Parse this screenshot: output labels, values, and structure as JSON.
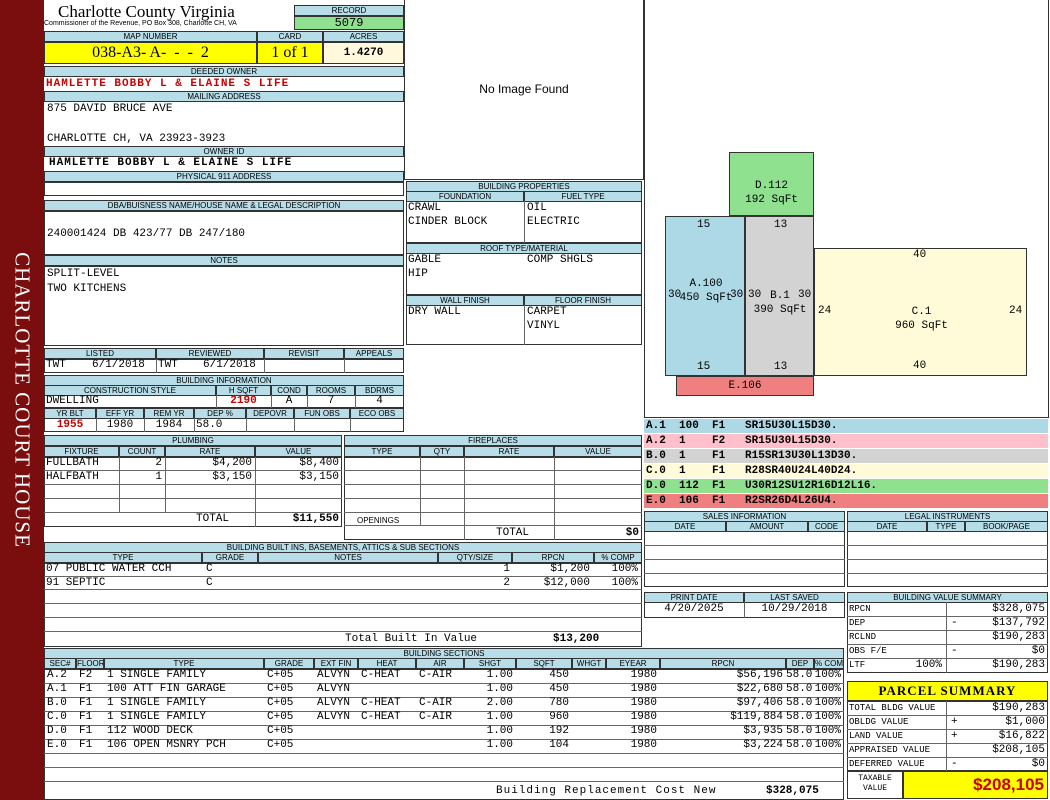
{
  "side_title": "CHARLOTTE COURT HOUSE",
  "header": {
    "county": "Charlotte County Virginia",
    "commissioner": "Commissioner of the Revenue, PO Box 308, Charlotte CH, VA",
    "record_label": "RECORD",
    "record": "5079",
    "map_number_label": "MAP NUMBER",
    "map_number": "038-A3- A-  -  -  2",
    "card_label": "CARD",
    "card": "1 of 1",
    "acres_label": "ACRES",
    "acres": "1.4270"
  },
  "owner": {
    "deeded_label": "DEEDED OWNER",
    "deeded_owner": "HAMLETTE BOBBY L & ELAINE S LIFE",
    "mailing_label": "MAILING ADDRESS",
    "mailing_line1": "875 DAVID BRUCE AVE",
    "mailing_line2": "",
    "mailing_line3": "CHARLOTTE CH, VA 23923-3923",
    "owner_id_label": "OWNER ID",
    "owner_id": "HAMLETTE BOBBY L & ELAINE S LIFE",
    "physical_label": "PHYSICAL 911 ADDRESS",
    "physical": ""
  },
  "dba": {
    "label": "DBA/BUISNESS NAME/HOUSE NAME & LEGAL DESCRIPTION",
    "text": "240001424 DB 423/77 DB 247/180"
  },
  "notes": {
    "label": "NOTES",
    "line1": "SPLIT-LEVEL",
    "line2": "TWO KITCHENS"
  },
  "image_placeholder": "No Image Found",
  "review": {
    "listed_label": "LISTED",
    "reviewed_label": "REVIEWED",
    "revisit_label": "REVISIT",
    "appeals_label": "APPEALS",
    "listed_by": "TWT",
    "listed_date": "6/1/2018",
    "reviewed_by": "TWT",
    "reviewed_date": "6/1/2018"
  },
  "building_info": {
    "label": "BUILDING INFORMATION",
    "style_label": "CONSTRUCTION STYLE",
    "hsqft_label": "H SQFT",
    "cond_label": "COND",
    "rooms_label": "ROOMS",
    "bdrms_label": "BDRMS",
    "style": "DWELLING",
    "hsqft": "2190",
    "cond": "A",
    "rooms": "7",
    "bdrms": "4",
    "yrblt_label": "YR BLT",
    "effyr_label": "EFF YR",
    "remyr_label": "REM YR",
    "dep_label": "DEP %",
    "depovr_label": "DEPOVR",
    "funobs_label": "FUN OBS",
    "ecoobs_label": "ECO OBS",
    "yrblt": "1955",
    "effyr": "1980",
    "remyr": "1984",
    "dep": "58.0"
  },
  "building_properties": {
    "label": "BUILDING PROPERTIES",
    "foundation_label": "FOUNDATION",
    "fuel_label": "FUEL TYPE",
    "foundation1": "CRAWL",
    "foundation2": "CINDER BLOCK",
    "fuel1": "OIL",
    "fuel2": "ELECTRIC",
    "roof_label": "ROOF TYPE/MATERIAL",
    "roof1": "GABLE",
    "roof2": "HIP",
    "roof_material": "COMP SHGLS",
    "wall_label": "WALL FINISH",
    "floor_label": "FLOOR FINISH",
    "wall": "DRY WALL",
    "floor1": "CARPET",
    "floor2": "VINYL"
  },
  "plumbing": {
    "label": "PLUMBING",
    "headers": [
      "FIXTURE",
      "COUNT",
      "RATE",
      "VALUE"
    ],
    "rows": [
      {
        "fixture": "FULLBATH",
        "count": "2",
        "rate": "$4,200",
        "value": "$8,400"
      },
      {
        "fixture": "HALFBATH",
        "count": "1",
        "rate": "$3,150",
        "value": "$3,150"
      }
    ],
    "total_label": "TOTAL",
    "total": "$11,550"
  },
  "fireplaces": {
    "label": "FIREPLACES",
    "headers": [
      "TYPE",
      "QTY",
      "RATE",
      "VALUE"
    ],
    "openings_label": "OPENINGS",
    "total_label": "TOTAL",
    "total": "$0"
  },
  "built_ins": {
    "label": "BUILDING BUILT INS, BASEMENTS, ATTICS & SUB SECTIONS",
    "headers": [
      "TYPE",
      "GRADE",
      "NOTES",
      "QTY/SIZE",
      "RPCN",
      "% COMP"
    ],
    "rows": [
      {
        "type": "07 PUBLIC WATER CCH",
        "grade": "C",
        "qty": "1",
        "rpcn": "$1,200",
        "comp": "100%"
      },
      {
        "type": "91 SEPTIC",
        "grade": "C",
        "qty": "2",
        "rpcn": "$12,000",
        "comp": "100%"
      }
    ],
    "total_label": "Total Built In Value",
    "total": "$13,200"
  },
  "sketch": {
    "areas": [
      {
        "code": "D.112",
        "sqft": "192 SqFt",
        "color": "#8fe08f"
      },
      {
        "code": "A.100",
        "sqft": "450 SqFt",
        "color": "#add8e6"
      },
      {
        "code": "B.1",
        "sqft": "390 SqFt",
        "color": "#d3d3d3"
      },
      {
        "code": "C.1",
        "sqft": "960 SqFt",
        "color": "#fffbd8"
      },
      {
        "code": "E.106",
        "sqft": "",
        "color": "#f08080"
      }
    ],
    "dims": {
      "a_top": "15",
      "a_bottom": "15",
      "a_left": "30",
      "a_right": "30",
      "b_top": "13",
      "b_bottom": "13",
      "b_left": "30",
      "b_right": "30",
      "c_top": "40",
      "c_bottom": "40",
      "c_left": "24",
      "c_right": "24"
    }
  },
  "segments": [
    {
      "text": "A.1  100  F1   SR15U30L15D30.",
      "color": "#add8e6"
    },
    {
      "text": "A.2  1    F2   SR15U30L15D30.",
      "color": "#ffc0cb"
    },
    {
      "text": "B.0  1    F1   R15SR13U30L13D30.",
      "color": "#d3d3d3"
    },
    {
      "text": "C.0  1    F1   R28SR40U24L40D24.",
      "color": "#fffbd8"
    },
    {
      "text": "D.0  112  F1   U30R12SU12R16D12L16.",
      "color": "#8fe08f"
    },
    {
      "text": "E.0  106  F1   R2SR26D4L26U4.",
      "color": "#f08080"
    }
  ],
  "sales": {
    "label": "SALES INFORMATION",
    "headers": [
      "DATE",
      "AMOUNT",
      "CODE"
    ]
  },
  "legal": {
    "label": "LEGAL INSTRUMENTS",
    "headers": [
      "DATE",
      "TYPE",
      "BOOK/PAGE"
    ]
  },
  "dates": {
    "print_label": "PRINT DATE",
    "saved_label": "LAST SAVED",
    "print": "4/20/2025",
    "saved": "10/29/2018"
  },
  "value_summary": {
    "label": "BUILDING VALUE SUMMARY",
    "rows": [
      {
        "label": "RPCN",
        "sign": "",
        "value": "$328,075"
      },
      {
        "label": "DEP",
        "sign": "-",
        "value": "$137,792"
      },
      {
        "label": "RCLND",
        "sign": "",
        "value": "$190,283"
      },
      {
        "label": "OBS F/E",
        "sign": "-",
        "value": "$0"
      },
      {
        "label": "LTF",
        "pct": "100%",
        "sign": "",
        "value": "$190,283"
      }
    ]
  },
  "parcel": {
    "label": "PARCEL SUMMARY",
    "rows": [
      {
        "label": "TOTAL BLDG VALUE",
        "sign": "",
        "value": "$190,283"
      },
      {
        "label": "OBLDG VALUE",
        "sign": "+",
        "value": "$1,000"
      },
      {
        "label": "LAND VALUE",
        "sign": "+",
        "value": "$16,822"
      },
      {
        "label": "APPRAISED VALUE",
        "sign": "",
        "value": "$208,105"
      },
      {
        "label": "DEFERRED VALUE",
        "sign": "-",
        "value": "$0"
      }
    ],
    "taxable_label1": "TAXABLE",
    "taxable_label2": "VALUE",
    "taxable": "$208,105"
  },
  "sections": {
    "label": "BUILDING SECTIONS",
    "headers": [
      "SEC#",
      "FLOOR",
      "TYPE",
      "GRADE",
      "EXT FIN",
      "HEAT",
      "AIR",
      "SHGT",
      "SQFT",
      "WHGT",
      "EYEAR",
      "RPCN",
      "DEP",
      "% COMP"
    ],
    "rows": [
      [
        "A.2",
        "F2",
        "1 SINGLE FAMILY",
        "C+05",
        "ALVYN",
        "C-HEAT",
        "C-AIR",
        "1.00",
        "450",
        "",
        "1980",
        "$56,196",
        "58.0",
        "100%"
      ],
      [
        "A.1",
        "F1",
        "100 ATT FIN GARAGE",
        "C+05",
        "ALVYN",
        "",
        "",
        "1.00",
        "450",
        "",
        "1980",
        "$22,680",
        "58.0",
        "100%"
      ],
      [
        "B.0",
        "F1",
        "1 SINGLE FAMILY",
        "C+05",
        "ALVYN",
        "C-HEAT",
        "C-AIR",
        "2.00",
        "780",
        "",
        "1980",
        "$97,406",
        "58.0",
        "100%"
      ],
      [
        "C.0",
        "F1",
        "1 SINGLE FAMILY",
        "C+05",
        "ALVYN",
        "C-HEAT",
        "C-AIR",
        "1.00",
        "960",
        "",
        "1980",
        "$119,884",
        "58.0",
        "100%"
      ],
      [
        "D.0",
        "F1",
        "112 WOOD DECK",
        "C+05",
        "",
        "",
        "",
        "1.00",
        "192",
        "",
        "1980",
        "$3,935",
        "58.0",
        "100%"
      ],
      [
        "E.0",
        "F1",
        "106 OPEN MSNRY PCH",
        "C+05",
        "",
        "",
        "",
        "1.00",
        "104",
        "",
        "1980",
        "$3,224",
        "58.0",
        "100%"
      ]
    ],
    "total_label": "Building Replacement Cost New",
    "total": "$328,075"
  },
  "colors": {
    "header_blue": "#b7dde8",
    "highlight_yellow": "#ffff00",
    "record_green": "#8fe08f",
    "accent_red": "#cc0000",
    "sidebar": "#7a0d0d"
  }
}
